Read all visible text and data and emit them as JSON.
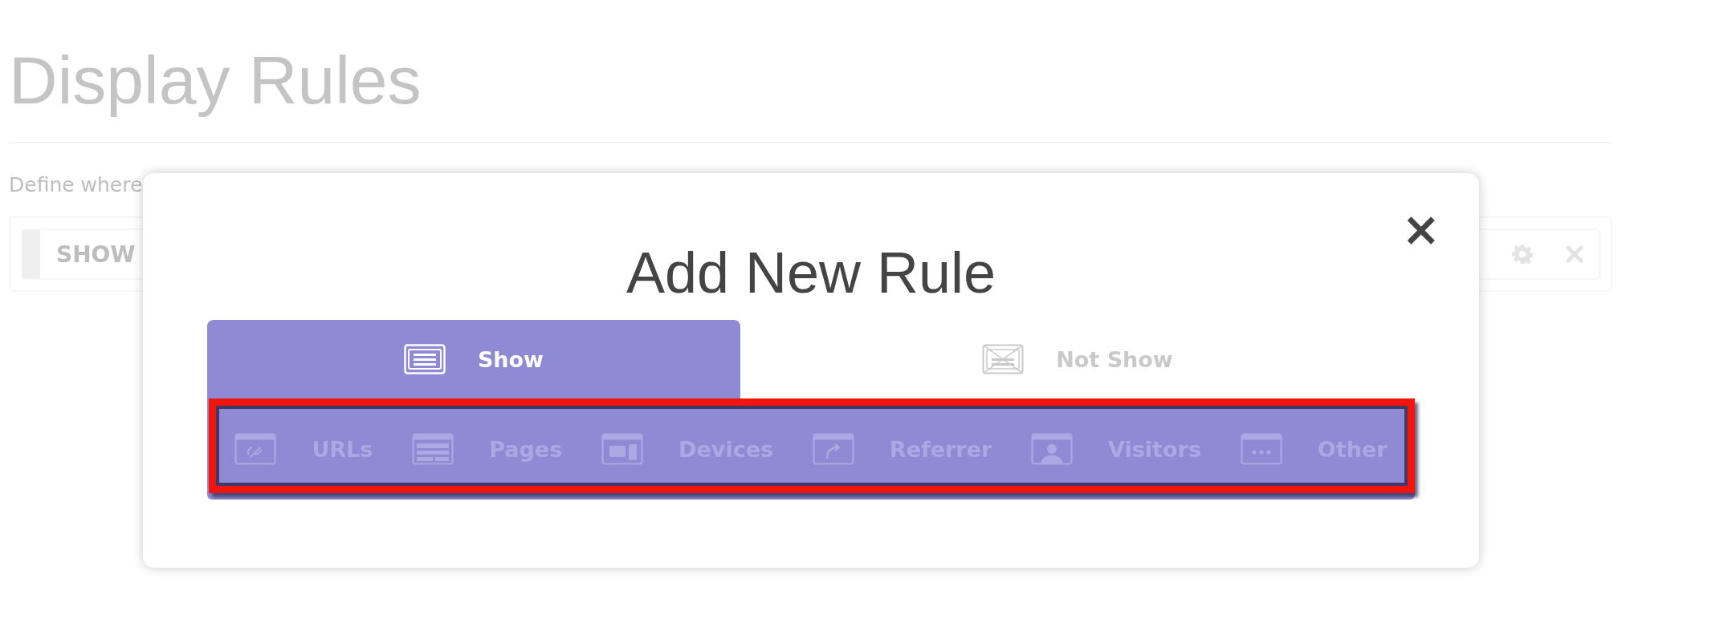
{
  "page": {
    "title": "Display Rules",
    "description": "Define where",
    "rule": {
      "label": "SHOW"
    }
  },
  "modal": {
    "title": "Add New Rule",
    "close": "×",
    "tabs": [
      {
        "label": "Show",
        "selected": true
      },
      {
        "label": "Not Show",
        "selected": false
      }
    ],
    "categories": [
      {
        "label": "URLs"
      },
      {
        "label": "Pages"
      },
      {
        "label": "Devices"
      },
      {
        "label": "Referrer"
      },
      {
        "label": "Visitors"
      },
      {
        "label": "Other"
      }
    ],
    "highlighted": true
  }
}
